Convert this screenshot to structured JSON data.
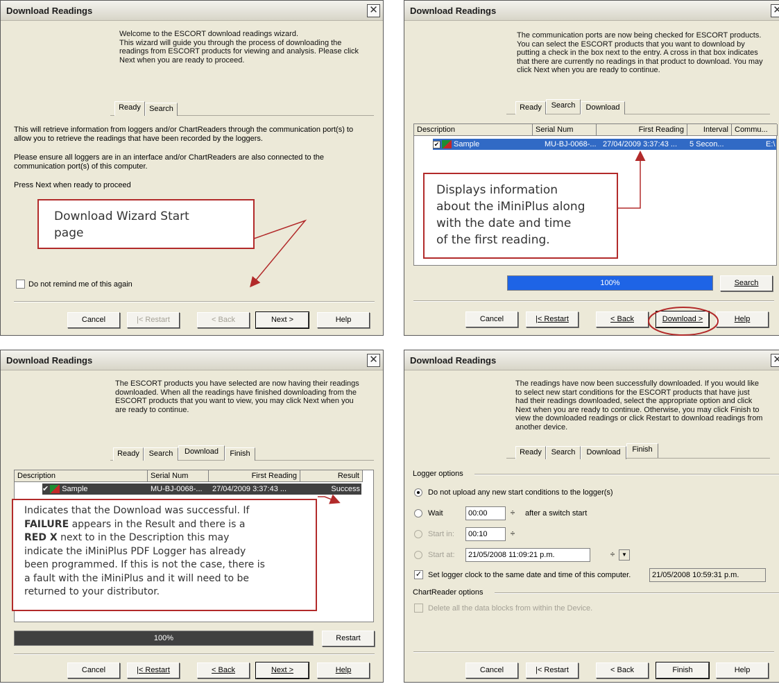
{
  "window_title": "Download Readings",
  "close_glyph": "✕",
  "tabs": {
    "ready": "Ready",
    "search": "Search",
    "download": "Download",
    "finish": "Finish"
  },
  "buttons": {
    "cancel": "Cancel",
    "restart": "|< Restart",
    "back": "< Back",
    "next": "Next >",
    "help": "Help",
    "download": "Download >",
    "search": "Search",
    "restart_plain": "Restart",
    "finish": "Finish"
  },
  "panel1": {
    "intro": "Welcome to the ESCORT download readings wizard.\nThis wizard will guide you through the process of downloading the\nreadings from ESCORT products for viewing and analysis. Please click\nNext when you are ready to proceed.",
    "body1": "This will retrieve information from loggers and/or ChartReaders through the communication port(s) to\nallow you to retrieve the readings that have been recorded by the loggers.",
    "body2": "Please ensure all loggers are in an interface and/or ChartReaders are also connected to the\ncommunication port(s) of this computer.",
    "body3": "Press Next when ready to proceed",
    "reminder": "Do not remind me of this again",
    "callout": "Download Wizard Start\npage"
  },
  "panel2": {
    "intro": "The communication ports are now being checked for ESCORT products.\nYou can select the ESCORT products that you want to download by\nputting a check in the box next to the entry. A cross in that box indicates\nthat there are currently no readings in that product to download. You may\nclick Next when you are ready to continue.",
    "columns": [
      "Description",
      "Serial Num",
      "First Reading",
      "Interval",
      "Commu..."
    ],
    "row": {
      "checkmark": "✔",
      "description": "Sample",
      "serial": "MU-BJ-0068-...",
      "first_reading": "27/04/2009  3:37:43 ...",
      "interval": "5 Secon...",
      "comm": "E:\\"
    },
    "progress_label": "100%",
    "progress_value": 1.0,
    "callout": "Displays information\nabout the iMiniPlus along\nwith the date and time\nof the first reading."
  },
  "panel3": {
    "intro": "The ESCORT products you have selected are now having their readings\ndownloaded. When all the readings have finished downloading from the\nESCORT products that you want to view, you may click Next when you\nare ready to continue.",
    "columns": [
      "Description",
      "Serial Num",
      "First Reading",
      "Result"
    ],
    "row": {
      "checkmark": "✔",
      "description": "Sample",
      "serial": "MU-BJ-0068-...",
      "first_reading": "27/04/2009  3:37:43 ...",
      "result": "Success"
    },
    "progress_label": "100%",
    "progress_value": 1.0,
    "callout_lines": [
      "Indicates that the Download was successful. If",
      "**FAILURE** appears in the Result and there is a",
      "**RED X** next to in the Description this may",
      "indicate the iMiniPlus PDF Logger has already",
      "been programmed. If this is not the case, there is",
      "a fault with the iMiniPlus and it will need to be",
      "returned to your distributor."
    ],
    "callout_line1": "Indicates that the Download was successful. If",
    "callout_bold1": "FAILURE",
    "callout_line2_rest": " appears in the Result and there is a",
    "callout_bold2": "RED X",
    "callout_line3_rest": " next to in the Description this may",
    "callout_line4": "indicate the iMiniPlus PDF Logger has already",
    "callout_line5": "been programmed. If this is not the case, there is",
    "callout_line6": "a fault with the iMiniPlus and it will need to be",
    "callout_line7": "returned to your distributor."
  },
  "panel4": {
    "intro": "The readings have now been successfully downloaded. If you would like\nto select new start conditions for the ESCORT products that have just\nhad their readings downloaded, select the appropriate option and click\nNext when you are ready to continue. Otherwise, you may click Finish to\nview the downloaded readings or click Restart to download readings from\nanother device.",
    "logger_options": "Logger options",
    "opt_no_upload": "Do not upload any new start conditions to the logger(s)",
    "opt_wait": "Wait",
    "wait_value": "00:00",
    "after_switch": "after a switch start",
    "opt_start_in": "Start in:",
    "start_in_value": "00:10",
    "opt_start_at": "Start at:",
    "start_at_value": "21/05/2008  11:09:21 p.m.",
    "set_clock": "Set logger clock to the same date and time of this computer.",
    "clock_value": "21/05/2008  10:59:31 p.m.",
    "chartreader_options": "ChartReader options",
    "delete_blocks": "Delete all the data blocks from within the Device."
  },
  "colors": {
    "callout_border": "#b22a2a",
    "selection": "#316ac5",
    "progress": "#1e64e6",
    "progress_dark": "#404040"
  }
}
